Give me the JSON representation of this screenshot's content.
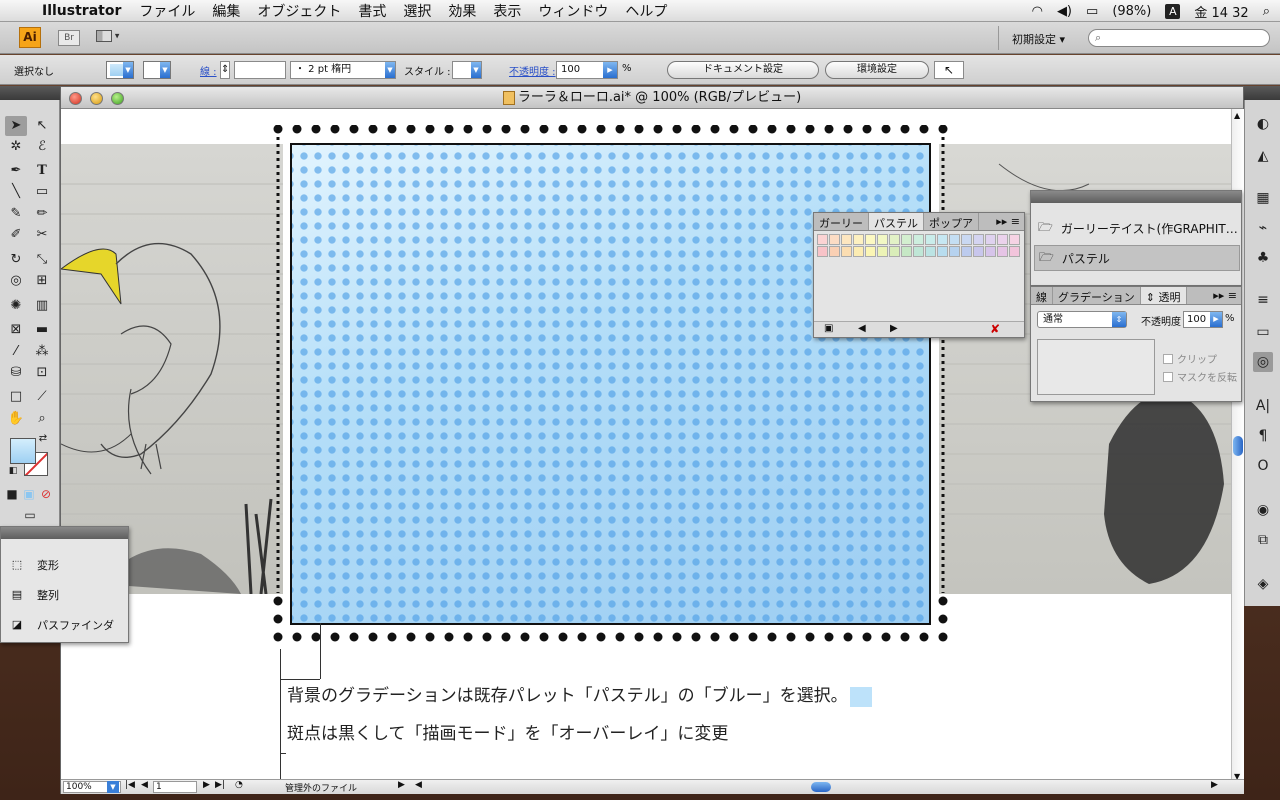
{
  "menubar": {
    "app_name": "Illustrator",
    "items": [
      "ファイル",
      "編集",
      "オブジェクト",
      "書式",
      "選択",
      "効果",
      "表示",
      "ウィンドウ",
      "ヘルプ"
    ],
    "battery": "(98%)",
    "input_mode": "A",
    "clock": "金 14 32"
  },
  "appbar": {
    "logo": "Ai",
    "bridge": "Br",
    "workspace": "初期設定 ▾",
    "search_placeholder": ""
  },
  "controlbar": {
    "selection": "選択なし",
    "stroke_label": "線 :",
    "stroke_profile": "・  2 pt 楕円",
    "style_label": "スタイル :",
    "opacity_label": "不透明度 :",
    "opacity_value": "100",
    "percent": "%",
    "doc_settings": "ドキュメント設定",
    "preferences": "環境設定"
  },
  "document": {
    "title": "ラーラ＆ローロ.ai* @ 100% (RGB/プレビュー)",
    "annotation_1": "背景のグラデーションは既存パレット「パステル」の「ブルー」を選択。",
    "annotation_2": "斑点は黒くして「描画モード」を「オーバーレイ」に変更",
    "zoom": "100%",
    "page": "1",
    "status": "管理外のファイル"
  },
  "transform_panel": {
    "items": [
      {
        "label": "変形",
        "icon": "transform-icon"
      },
      {
        "label": "整列",
        "icon": "align-icon"
      },
      {
        "label": "パスファインダ",
        "icon": "pathfinder-icon"
      }
    ]
  },
  "swatch_panel": {
    "tabs": [
      "ガーリー",
      "パステル",
      "ポップア"
    ],
    "active_tab": "パステル",
    "colors_row1": [
      "#fbd3d3",
      "#fcdcc4",
      "#fde6c0",
      "#fdf0c0",
      "#fcf8c2",
      "#f2f7c4",
      "#e2f2c6",
      "#d3efcf",
      "#cdeede",
      "#c9ecea",
      "#c6e7f2",
      "#c4def3",
      "#c9d8f2",
      "#d4d4f1",
      "#dfd2ef",
      "#ebd2ec",
      "#f6d3e4"
    ],
    "colors_row2": [
      "#f8c3c8",
      "#fad0b4",
      "#fbddb1",
      "#fcecb2",
      "#fbf5b4",
      "#ecf3b6",
      "#d9edb9",
      "#c6e8c5",
      "#bfe6d6",
      "#bbe3e3",
      "#b8ddef",
      "#b6d2ef",
      "#bccbee",
      "#c8c6ec",
      "#d6c4ea",
      "#e6c4e6",
      "#f2c4db"
    ]
  },
  "library_panel": {
    "items": [
      "ガーリーテイスト(作GRAPHIT…",
      "パステル"
    ]
  },
  "transparency_panel": {
    "tabs": [
      "線",
      "グラデーション",
      "⇕ 透明"
    ],
    "blend_mode": "通常",
    "opacity_label": "不透明度 :",
    "opacity_value": "100",
    "percent": "%",
    "clip": "クリップ",
    "invert_mask": "マスクを反転"
  }
}
